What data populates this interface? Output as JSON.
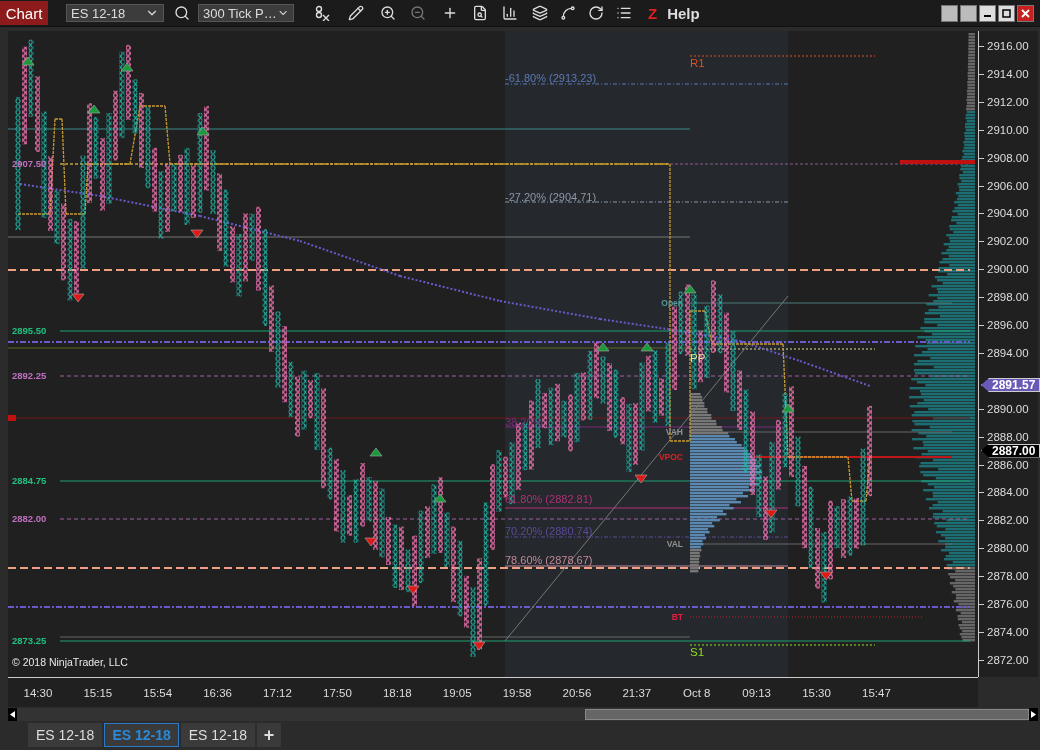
{
  "toolbar": {
    "chart_button": "Chart",
    "instrument": "ES 12-18",
    "interval": "300 Tick P…",
    "z_label": "Z",
    "help": "Help"
  },
  "chart": {
    "level_labels": [
      {
        "text": "2907.50",
        "color": "#c070c0"
      },
      {
        "text": "2895.50",
        "color": "#20c080"
      },
      {
        "text": "2892.25",
        "color": "#c070c0"
      },
      {
        "text": "2884.75",
        "color": "#20c080"
      },
      {
        "text": "2882.00",
        "color": "#c070c0"
      },
      {
        "text": "2873.25",
        "color": "#20c080"
      }
    ],
    "fib_labels": [
      {
        "text": "-61.80% (2913.23)",
        "color": "#5a7ab8"
      },
      {
        "text": "-27.20% (2904.71)",
        "color": "#8a98a8"
      },
      {
        "text": "38.20%",
        "color": "#7a2a7a"
      },
      {
        "text": "61.80% (2882.81)",
        "color": "#b03078"
      },
      {
        "text": "70.20% (2880.74)",
        "color": "#5a4a9a"
      },
      {
        "text": "78.60% (2878.67)",
        "color": "#c08898"
      }
    ],
    "pivot_labels": [
      {
        "text": "R1",
        "color": "#e05020"
      },
      {
        "text": "PP",
        "color": "#e8e0a0"
      },
      {
        "text": "S1",
        "color": "#90e020"
      }
    ],
    "profile_labels": [
      {
        "text": "Open",
        "color": "#5a9a9a"
      },
      {
        "text": "VAH",
        "color": "#909090"
      },
      {
        "text": "VPOC",
        "color": "#e02020"
      },
      {
        "text": "VAL",
        "color": "#909090"
      },
      {
        "text": "BT",
        "color": "#e02040"
      }
    ],
    "copyright": "© 2018 NinjaTrader, LLC"
  },
  "price_axis": {
    "labels": [
      "2916.00",
      "2914.00",
      "2912.00",
      "2910.00",
      "2908.00",
      "2906.00",
      "2904.00",
      "2902.00",
      "2900.00",
      "2898.00",
      "2896.00",
      "2894.00",
      "2890.00",
      "2888.00",
      "2886.00",
      "2884.00",
      "2882.00",
      "2880.00",
      "2878.00",
      "2876.00",
      "2874.00",
      "2872.00"
    ],
    "markers": [
      {
        "text": "2891.57",
        "color": "#6a5ab8"
      },
      {
        "text": "2887.00",
        "color": "#000000"
      }
    ]
  },
  "time_axis": {
    "labels": [
      "14:30",
      "15:15",
      "15:54",
      "16:36",
      "17:12",
      "17:50",
      "18:18",
      "19:05",
      "19:58",
      "20:56",
      "21:37",
      "Oct 8",
      "09:13",
      "15:30",
      "15:47"
    ]
  },
  "tabs": [
    {
      "label": "ES 12-18",
      "selected": false
    },
    {
      "label": "ES 12-18",
      "selected": true
    },
    {
      "label": "ES 12-18",
      "selected": false
    }
  ],
  "add_tab": "+"
}
